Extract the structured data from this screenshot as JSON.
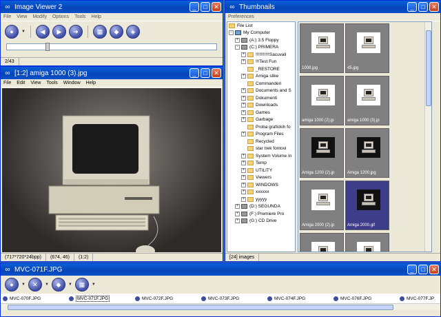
{
  "viewer_window": {
    "title": "Image Viewer 2",
    "menu": [
      "File",
      "View",
      "Modify",
      "Options",
      "Tools",
      "Help"
    ],
    "status": "2/43"
  },
  "image_window": {
    "title": "[1:2] amiga 1000 (3).jpg",
    "menu": [
      "File",
      "Edit",
      "View",
      "Tools",
      "Window",
      "Help"
    ],
    "status": [
      "(717*720*24bpp)",
      "(674, 46)",
      "(1:2)"
    ]
  },
  "thumbs_window": {
    "title": "Thumbnails",
    "menu": [
      "Preferences"
    ],
    "status": "[24] images",
    "tree": [
      {
        "label": "File List",
        "icon": "file",
        "indent": 0
      },
      {
        "label": "My Computer",
        "icon": "pc",
        "indent": 0,
        "exp": "-"
      },
      {
        "label": "(A:) 3.5 Floppy",
        "icon": "drive",
        "indent": 1,
        "exp": "+"
      },
      {
        "label": "(C:) PRIMERA",
        "icon": "drive",
        "indent": 1,
        "exp": "-"
      },
      {
        "label": "!!!!!!!!!!!Sacuvali",
        "icon": "folder",
        "indent": 2,
        "exp": "+"
      },
      {
        "label": "!!!Test Fun",
        "icon": "folder",
        "indent": 2,
        "exp": "+"
      },
      {
        "label": "_RESTORE",
        "icon": "folder",
        "indent": 2,
        "exp": ""
      },
      {
        "label": "Amiga slike",
        "icon": "folder",
        "indent": 2,
        "exp": "+"
      },
      {
        "label": "Commanderi",
        "icon": "folder",
        "indent": 2,
        "exp": ""
      },
      {
        "label": "Documents and S",
        "icon": "folder",
        "indent": 2,
        "exp": "+"
      },
      {
        "label": "Dokumenti",
        "icon": "folder",
        "indent": 2,
        "exp": "+"
      },
      {
        "label": "Downloads",
        "icon": "folder",
        "indent": 2,
        "exp": "+"
      },
      {
        "label": "Games",
        "icon": "folder",
        "indent": 2,
        "exp": "+"
      },
      {
        "label": "Garbage",
        "icon": "folder",
        "indent": 2,
        "exp": "+"
      },
      {
        "label": "Proba grafickih fo",
        "icon": "folder",
        "indent": 2,
        "exp": ""
      },
      {
        "label": "Program Files",
        "icon": "folder",
        "indent": 2,
        "exp": "+"
      },
      {
        "label": "Recycled",
        "icon": "folder",
        "indent": 2,
        "exp": ""
      },
      {
        "label": "star trek fontovi",
        "icon": "folder",
        "indent": 2,
        "exp": ""
      },
      {
        "label": "System Volume In",
        "icon": "folder",
        "indent": 2,
        "exp": "+"
      },
      {
        "label": "Temp",
        "icon": "folder",
        "indent": 2,
        "exp": "+"
      },
      {
        "label": "UTILITY",
        "icon": "folder",
        "indent": 2,
        "exp": "+"
      },
      {
        "label": "Viewers",
        "icon": "folder",
        "indent": 2,
        "exp": "+"
      },
      {
        "label": "WINDOWS",
        "icon": "folder",
        "indent": 2,
        "exp": "+"
      },
      {
        "label": "xxxxxx",
        "icon": "folder",
        "indent": 2,
        "exp": "+"
      },
      {
        "label": "yyyyy",
        "icon": "folder",
        "indent": 2,
        "exp": "+"
      },
      {
        "label": "(D:) SEGUNDA",
        "icon": "drive",
        "indent": 1,
        "exp": "+"
      },
      {
        "label": "(F:) Premiere Pro",
        "icon": "drive",
        "indent": 1,
        "exp": "+"
      },
      {
        "label": "(G:) CD Drive",
        "icon": "drive",
        "indent": 1,
        "exp": "+"
      }
    ],
    "thumbnails": [
      {
        "label": "1008.jpg",
        "dark": false,
        "selected": false
      },
      {
        "label": "45.jpg",
        "dark": false,
        "selected": false
      },
      {
        "label": "amiga 1000 (2).jp",
        "dark": false,
        "selected": false
      },
      {
        "label": "amiga 1000 (3).jp",
        "dark": false,
        "selected": false
      },
      {
        "label": "Amiga 1200 (2).jp",
        "dark": true,
        "selected": false
      },
      {
        "label": "Amiga 1200.jpg",
        "dark": true,
        "selected": false
      },
      {
        "label": "Amiga 2000 (2).jp",
        "dark": false,
        "selected": false
      },
      {
        "label": "Amiga 2000.gif",
        "dark": true,
        "selected": true
      },
      {
        "label": "",
        "dark": false,
        "selected": false
      },
      {
        "label": "",
        "dark": false,
        "selected": false
      }
    ]
  },
  "filmstrip_window": {
    "title": "MVC-071F.JPG",
    "files": [
      "MVC-070F.JPG",
      "MVC-071F.JPG",
      "MVC-072F.JPG",
      "MVC-073F.JPG",
      "MVC-074F.JPG",
      "MVC-076F.JPG",
      "MVC-077F.JP"
    ],
    "selected": 1
  },
  "colors": {
    "titlebar": "#0a52c9",
    "selection": "#3d3d8a",
    "desktop": "#3a6ea5"
  }
}
